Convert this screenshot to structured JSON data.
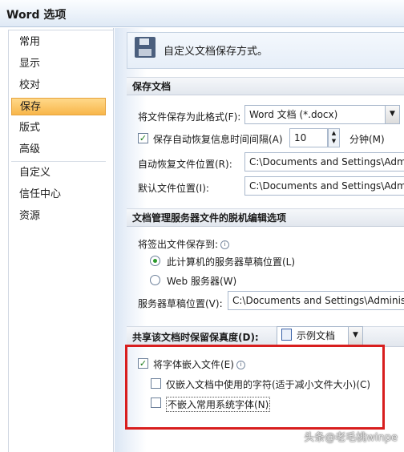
{
  "window": {
    "title": "Word 选项"
  },
  "sidebar": {
    "items": [
      "常用",
      "显示",
      "校对",
      "保存",
      "版式",
      "高级",
      "自定义",
      "信任中心",
      "资源"
    ],
    "active_index": 3
  },
  "header": {
    "text": "自定义文档保存方式。"
  },
  "save": {
    "section_title": "保存文档",
    "format_label": "将文件保存为此格式(F):",
    "format_value": "Word 文档 (*.docx)",
    "autorecover_label": "保存自动恢复信息时间间隔(A)",
    "autorecover_checked": true,
    "interval_value": "10",
    "minutes_label": "分钟(M)",
    "autorecover_path_label": "自动恢复文件位置(R):",
    "autorecover_path_value": "C:\\Documents and Settings\\Administrator",
    "default_path_label": "默认文件位置(I):",
    "default_path_value": "C:\\Documents and Settings\\Administrator"
  },
  "offline": {
    "section_title": "文档管理服务器文件的脱机编辑选项",
    "checkout_label": "将签出文件保存到:",
    "radio_local": "此计算机的服务器草稿位置(L)",
    "radio_web": "Web 服务器(W)",
    "selected": "local",
    "drafts_label": "服务器草稿位置(V):",
    "drafts_value": "C:\\Documents and Settings\\Administrator"
  },
  "fidelity": {
    "section_title": "共享该文档时保留保真度(D):",
    "doc_value": "示例文档",
    "embed_fonts_label": "将字体嵌入文件(E)",
    "embed_fonts_checked": true,
    "only_used_label": "仅嵌入文档中使用的字符(适于减小文件大小)(C)",
    "only_used_checked": false,
    "no_common_label": "不嵌入常用系统字体(N)",
    "no_common_checked": false
  },
  "watermark": {
    "text": "头条@老毛桃winpe"
  }
}
